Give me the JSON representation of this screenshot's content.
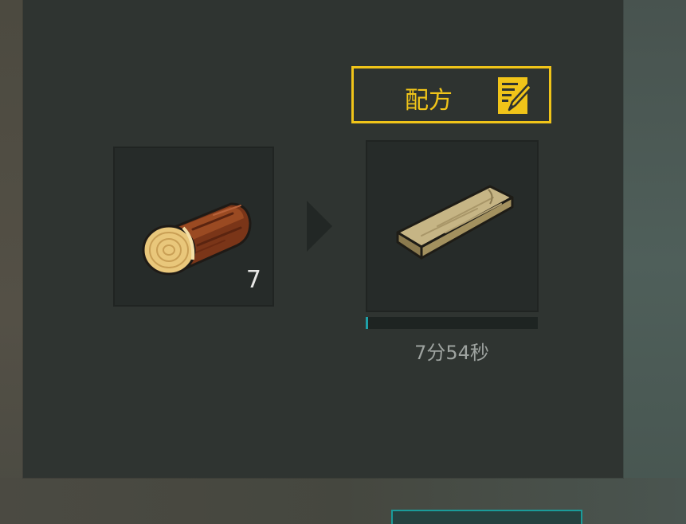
{
  "crafting": {
    "recipe_button_label": "配方",
    "input": {
      "item_icon": "log-icon",
      "count": "7"
    },
    "output": {
      "item_icon": "wood-plank-icon"
    },
    "progress_fraction": 0.01,
    "time_remaining": "7分54秒"
  },
  "colors": {
    "accent_yellow": "#f0c419",
    "progress_teal": "#1fa0a8",
    "panel_bg": "#2f3431"
  }
}
